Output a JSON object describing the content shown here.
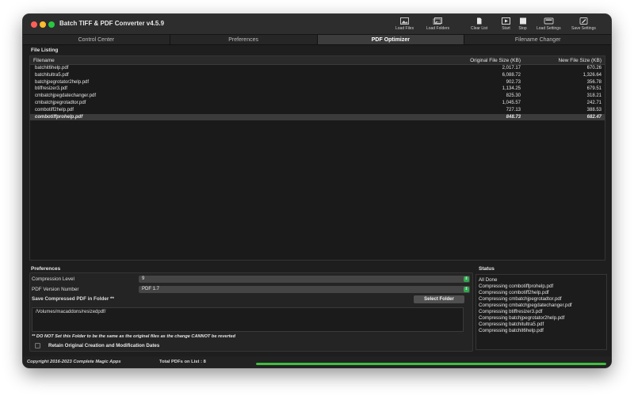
{
  "window": {
    "title": "Batch TIFF & PDF Converter v4.5.9"
  },
  "toolbar": [
    {
      "label": "Load Files",
      "icon": "photo-icon"
    },
    {
      "label": "Load Folders",
      "icon": "photos-icon"
    },
    {
      "label": "Clear List",
      "icon": "document-icon"
    },
    {
      "label": "Start",
      "icon": "play-icon"
    },
    {
      "label": "Stop",
      "icon": "stop-icon"
    },
    {
      "label": "Load Settings",
      "icon": "settings-tray-icon"
    },
    {
      "label": "Save Settings",
      "icon": "save-settings-icon"
    }
  ],
  "tabs": [
    {
      "label": "Control Center"
    },
    {
      "label": "Preferences"
    },
    {
      "label": "PDF Optimizer",
      "active": true
    },
    {
      "label": "Filename Changer"
    }
  ],
  "file_listing": {
    "title": "File Listing",
    "columns": [
      "Filename",
      "Original File Size (KB)",
      "New File Size (KB)"
    ],
    "rows": [
      {
        "name": "batchit6help.pdf",
        "orig": "2,017.17",
        "new": "670.26"
      },
      {
        "name": "batchitultra5.pdf",
        "orig": "6,088.72",
        "new": "1,326.64"
      },
      {
        "name": "batchjpegrotator2help.pdf",
        "orig": "902.73",
        "new": "356.78"
      },
      {
        "name": "btiffresizer3.pdf",
        "orig": "1,134.25",
        "new": "679.51"
      },
      {
        "name": "cmbatchjpegdatechanger.pdf",
        "orig": "825.30",
        "new": "318.21"
      },
      {
        "name": "cmbatchjpegrotadtor.pdf",
        "orig": "1,045.57",
        "new": "242.71"
      },
      {
        "name": "combotiff2help.pdf",
        "orig": "727.13",
        "new": "388.53"
      },
      {
        "name": "combotiffprohelp.pdf",
        "orig": "848.73",
        "new": "682.47",
        "selected": true
      }
    ]
  },
  "preferences": {
    "title": "Preferences",
    "compression_label": "Compression Level",
    "compression_value": "9",
    "pdf_version_label": "PDF Version Number",
    "pdf_version_value": "PDF 1.7",
    "save_folder_label": "Save Compressed PDF in Folder **",
    "select_folder_button": "Select Folder",
    "folder_path": "/Volumes/macaddons/resizedpdf/",
    "warning": "** DO NOT Set this Folder to be the same as the original files as the change CANNOT be reverted",
    "retain_dates_label": "Retain Original Creation and Modification Dates",
    "retain_dates_checked": false
  },
  "status": {
    "title": "Status",
    "lines": [
      "All Done",
      "Compressing combotiffprohelp.pdf",
      "Compressing combotiff2help.pdf",
      "Compressing cmbatchjpegrotadtor.pdf",
      "Compressing cmbatchjpegdatechanger.pdf",
      "Compressing btiffresizer3.pdf",
      "Compressing batchjpegrotator2help.pdf",
      "Compressing batchitultra5.pdf",
      "Compressing batchit6help.pdf"
    ]
  },
  "footer": {
    "copyright": "Copyright 2016-2023 Complete Magic Apps",
    "total_label": "Total PDFs on List : 8",
    "progress_fraction": 1.0
  },
  "colors": {
    "accent_green": "#3fbf3f",
    "window_bg": "#1e1e1e"
  }
}
